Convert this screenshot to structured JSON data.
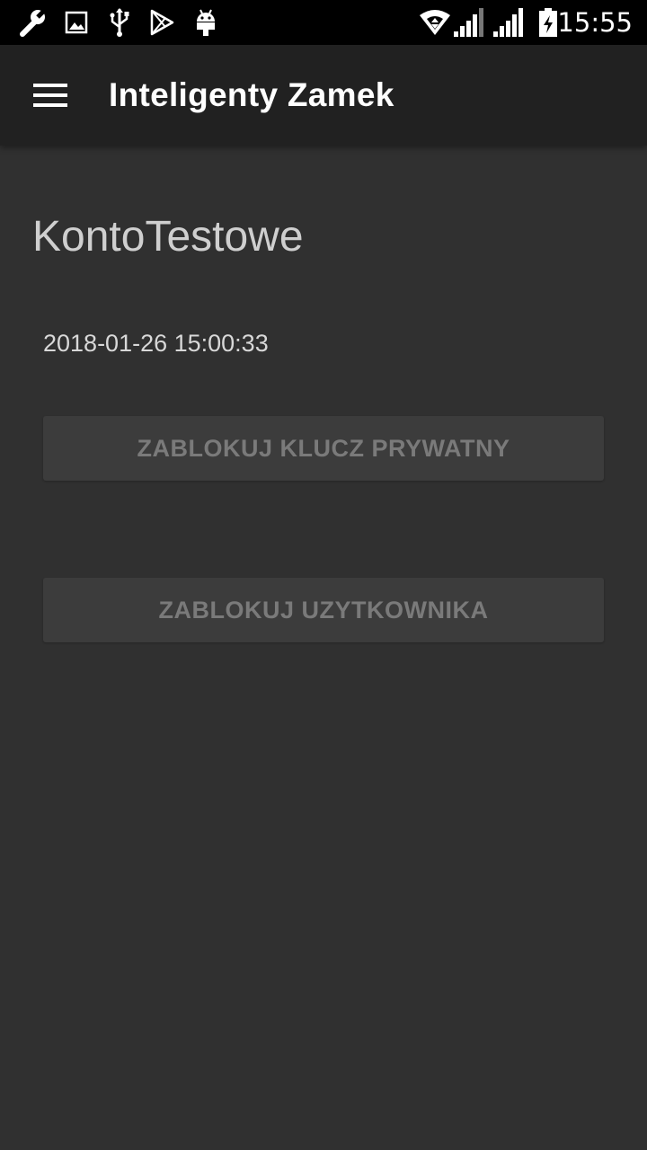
{
  "status_bar": {
    "time": "15:55",
    "left_icons": [
      "wrench-icon",
      "image-icon",
      "usb-icon",
      "play-store-icon",
      "android-icon"
    ],
    "right_icons": [
      "wifi-icon",
      "cell-signal-icon",
      "cell-signal-icon",
      "battery-charging-icon"
    ]
  },
  "app_bar": {
    "title": "Inteligenty Zamek",
    "menu_icon": "hamburger-menu-icon"
  },
  "account": {
    "name": "KontoTestowe",
    "timestamp": "2018-01-26 15:00:33"
  },
  "actions": {
    "block_private_key_label": "ZABLOKUJ KLUCZ PRYWATNY",
    "block_user_label": "ZABLOKUJ UZYTKOWNIKA"
  },
  "colors": {
    "status_bar_bg": "#000000",
    "app_bar_bg": "#212121",
    "content_bg": "#303030",
    "button_bg": "#3c3c3c",
    "button_text_disabled": "#7a7a7a"
  }
}
